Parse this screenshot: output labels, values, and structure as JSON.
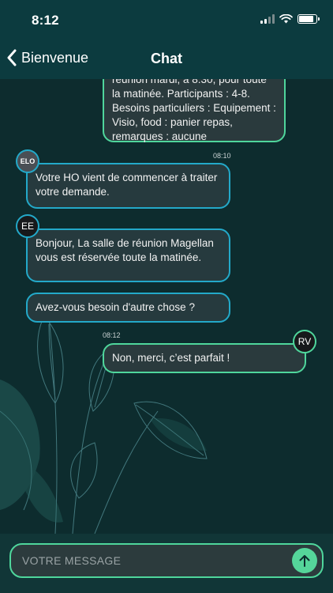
{
  "status_bar": {
    "time": "8:12"
  },
  "nav": {
    "back_label": "Bienvenue",
    "title": "Chat"
  },
  "messages": [
    {
      "text": "réunion mardi, à 8:30, pour toute la matinée. Participants : 4-8. Besoins particuliers : Equipement : Visio, food : panier repas, remarques : aucune"
    },
    {
      "timestamp": "08:10",
      "avatar": "ELO",
      "text": "Votre HO vient de commencer à traiter votre demande."
    },
    {
      "avatar": "EE",
      "text": "Bonjour, La salle de réunion Magellan vous est réservée toute la matinée."
    },
    {
      "text": "Avez-vous besoin d'autre chose ?"
    },
    {
      "timestamp": "08:12",
      "avatar": "RV",
      "text": "Non, merci, c’est parfait !"
    }
  ],
  "composer": {
    "placeholder": "VOTRE MESSAGE"
  },
  "colors": {
    "accent_blue": "#23a9c9",
    "accent_green": "#4fd69c",
    "header_bg": "#0c3b3f"
  },
  "icons": {
    "back": "chevron-left-icon",
    "send": "arrow-up-icon"
  }
}
